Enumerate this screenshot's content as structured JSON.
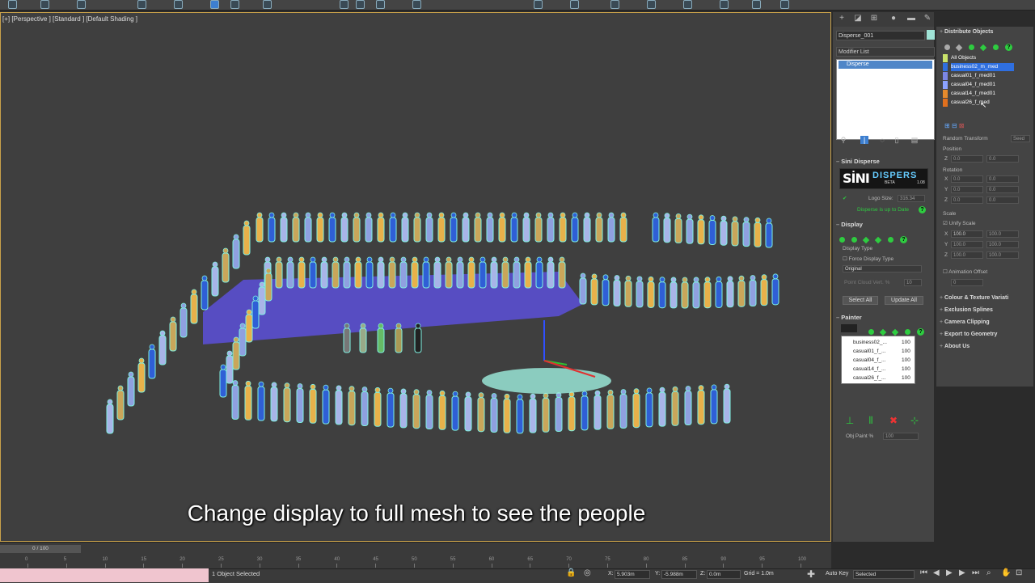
{
  "viewport": {
    "label": "[+] [Perspective ] [Standard ] [Default Shading ]",
    "subtitle": "Change display to full mesh to see the people"
  },
  "command_panel": {
    "object_name": "Disperse_001",
    "modifier_list_label": "Modifier List",
    "stack_items": [
      "Disperse"
    ],
    "rollouts": {
      "sini_disperse": {
        "title": "Sini Disperse",
        "logo_left": "SİNI",
        "logo_right": "DISPERS",
        "beta": "BETA",
        "version": "1.08",
        "logo_size_label": "Logo Size:",
        "logo_size_value": "316.34",
        "update_status": "Disperse is up to Date"
      },
      "display": {
        "title": "Display",
        "display_type_label": "Display Type",
        "force_display_type": "Force Display Type",
        "mode_value": "Original",
        "point_cloud_label": "Point Cloud Vert. %",
        "point_cloud_value": "10",
        "select_all": "Select All",
        "update_all": "Update All"
      },
      "painter": {
        "title": "Painter",
        "items": [
          {
            "name": "business02_...",
            "value": "100"
          },
          {
            "name": "casual01_f_...",
            "value": "100"
          },
          {
            "name": "casual04_f_...",
            "value": "100"
          },
          {
            "name": "casual14_f_...",
            "value": "100"
          },
          {
            "name": "casual26_f_...",
            "value": "100"
          }
        ],
        "obj_paint_label": "Obj Paint %",
        "obj_paint_value": "100"
      }
    }
  },
  "distribute_panel": {
    "title": "Distribute Objects",
    "objects": [
      {
        "name": "All Objects",
        "color": "#c9e36b",
        "selected": false
      },
      {
        "name": "business02_m_med",
        "color": "#2f6fe0",
        "selected": true
      },
      {
        "name": "casual01_f_med01",
        "color": "#7b86e6",
        "selected": false
      },
      {
        "name": "casual04_f_med01",
        "color": "#8ba2ff",
        "selected": false
      },
      {
        "name": "casual14_f_med01",
        "color": "#e58a2c",
        "selected": false
      },
      {
        "name": "casual26_f_med",
        "color": "#e0701e",
        "selected": false
      }
    ],
    "random_transform": "Random Transform",
    "seed": "Seed",
    "position_label": "Position",
    "position_z": "0.0",
    "position_z2": "0.0",
    "rotation_label": "Rotation",
    "rotation": [
      {
        "axis": "X",
        "min": "0.0",
        "max": "0.0"
      },
      {
        "axis": "Y",
        "min": "0.0",
        "max": "0.0"
      },
      {
        "axis": "Z",
        "min": "0.0",
        "max": "0.0"
      }
    ],
    "scale_label": "Scale",
    "unify_scale": "Unify Scale",
    "scale": [
      {
        "axis": "X",
        "min": "100.0",
        "max": "100.0"
      },
      {
        "axis": "Y",
        "min": "100.0",
        "max": "100.0"
      },
      {
        "axis": "Z",
        "min": "100.0",
        "max": "100.0"
      }
    ],
    "animation_offset": "Animation Offset",
    "animation_offset_value": "0",
    "sections": [
      "Colour & Texture Variati",
      "Exclusion Splines",
      "Camera Clipping",
      "Export to Geometry",
      "About Us"
    ]
  },
  "timeline": {
    "frame_label": "0 / 100",
    "ticks": [
      "0",
      "5",
      "10",
      "15",
      "20",
      "25",
      "30",
      "35",
      "40",
      "45",
      "50",
      "55",
      "60",
      "65",
      "70",
      "75",
      "80",
      "85",
      "90",
      "95",
      "100"
    ]
  },
  "status_bar": {
    "selection": "1 Object Selected",
    "x_label": "X:",
    "x_value": "5.903m",
    "y_label": "Y:",
    "y_value": "-5.988m",
    "z_label": "Z:",
    "z_value": "0.0m",
    "grid": "Grid = 1.0m",
    "autokey": "Auto Key",
    "selected_dropdown": "Selected"
  }
}
